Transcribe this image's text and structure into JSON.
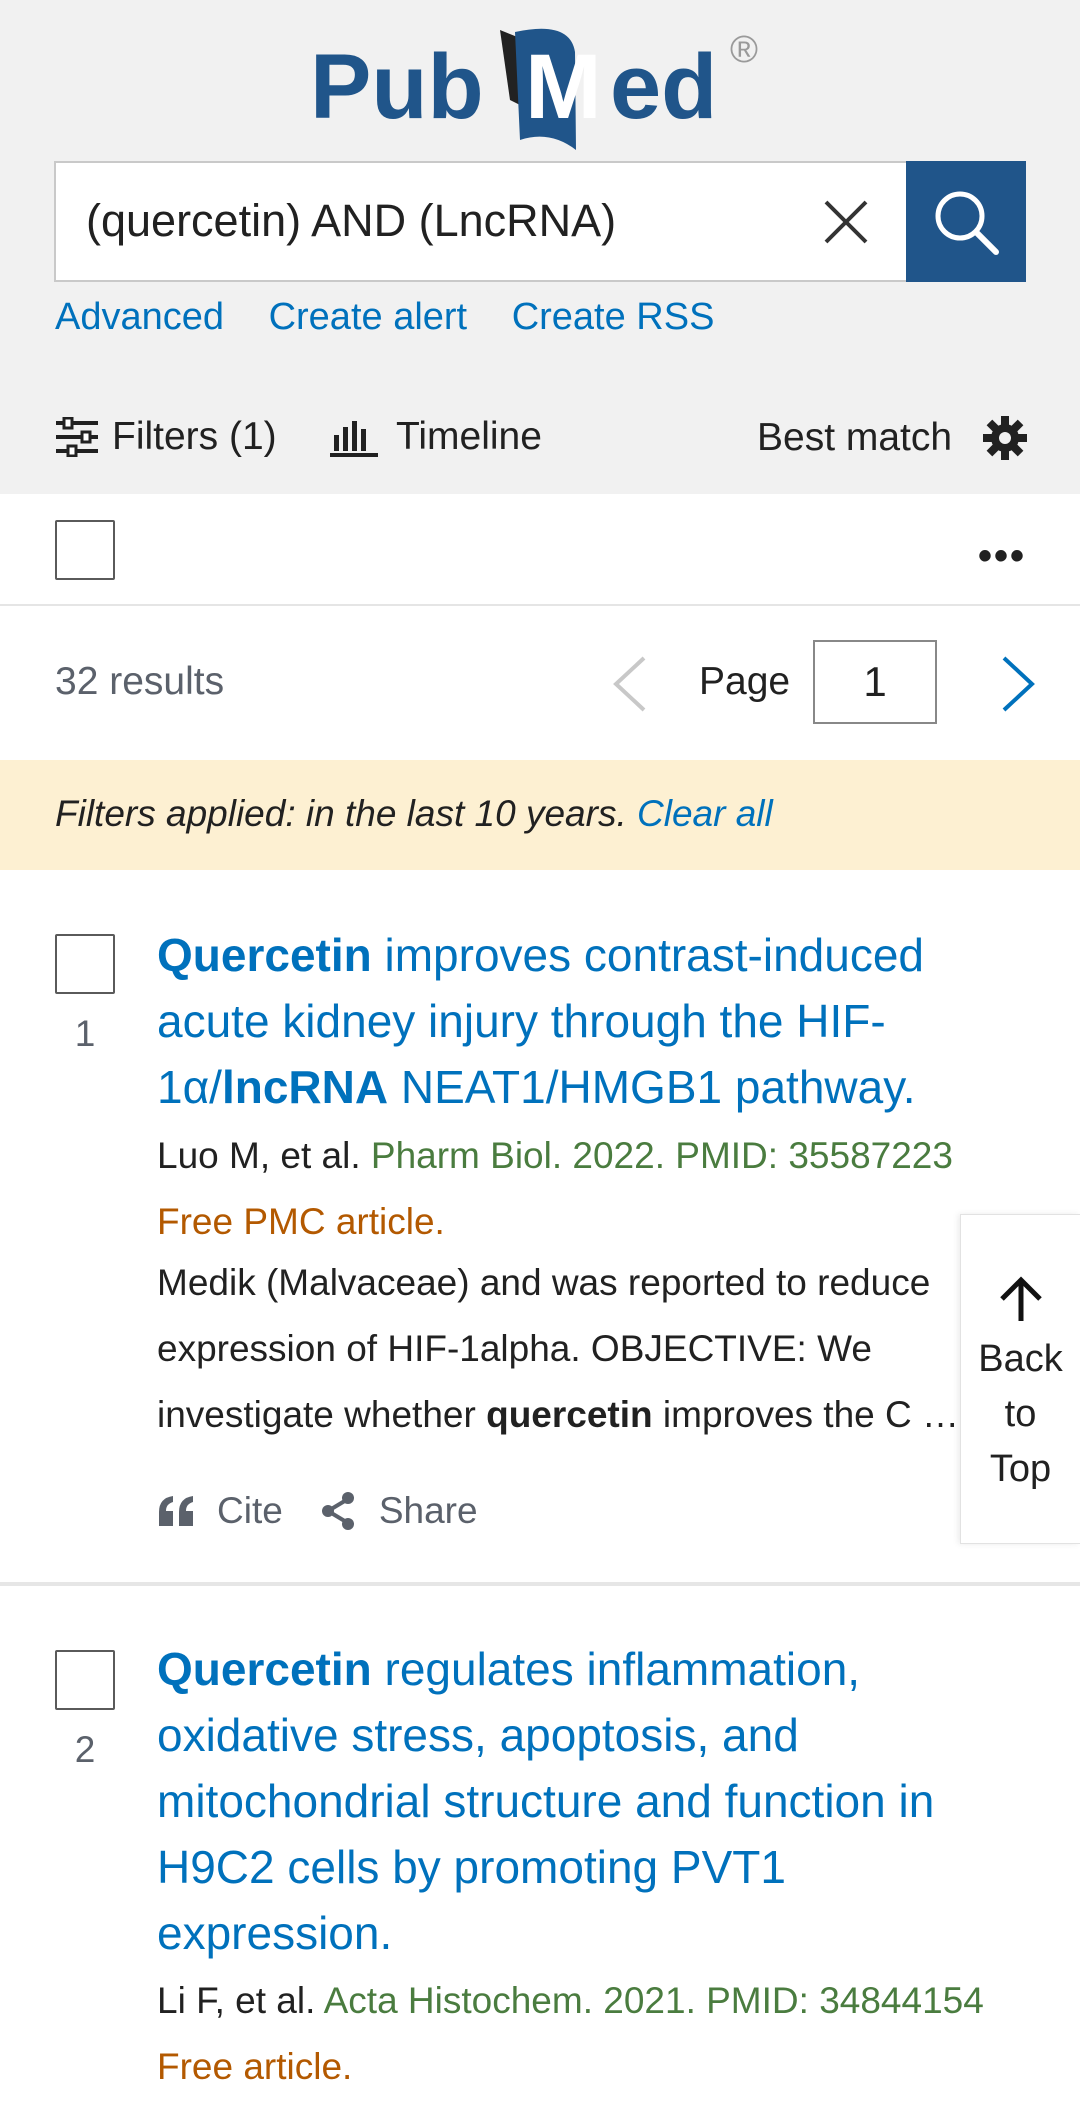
{
  "header": {
    "logo_text": "PubMed",
    "logo_registered": "®",
    "search_value": "(quercetin) AND (LncRNA)",
    "links": [
      "Advanced",
      "Create alert",
      "Create RSS"
    ]
  },
  "toolbar": {
    "filters_label": "Filters (1)",
    "timeline_label": "Timeline",
    "sort_label": "Best match"
  },
  "results": {
    "count_text": "32 results",
    "page_label": "Page",
    "page_value": "1"
  },
  "filter_bar": {
    "text": "Filters applied: in the last 10 years.",
    "clear_label": "Clear all"
  },
  "articles": [
    {
      "number": "1",
      "title_parts": [
        "Quercetin",
        " improves contrast-induced acute kidney injury through the HIF-1α/",
        "lncRNA",
        " NEAT1/HMGB1 pathway."
      ],
      "authors": "Luo M, et al.",
      "journal": "Pharm Biol. 2022. PMID: 35587223",
      "free": "Free PMC article.",
      "snippet_lines": [
        "Medik (Malvaceae) and was reported to reduce",
        "expression of HIF-1alpha. OBJECTIVE: We"
      ],
      "snippet_line3_pre": "investigate whether ",
      "snippet_line3_bold": "quercetin",
      "snippet_line3_post": " improves the C …",
      "cite_label": "Cite",
      "share_label": "Share"
    },
    {
      "number": "2",
      "title_parts": [
        "Quercetin",
        " regulates inflammation, oxidative stress, apoptosis, and mitochondrial structure and function in H9C2 cells by promoting PVT1 expression."
      ],
      "authors": "Li F, et al.",
      "journal": "Acta Histochem. 2021. PMID: 34844154",
      "free": "Free article."
    }
  ],
  "back_to_top": {
    "line1": "Back",
    "line2": "to",
    "line3": "Top"
  },
  "colors": {
    "brand_blue": "#20558a",
    "link_blue": "#0071bc",
    "journal_green": "#4a7c3f",
    "free_orange": "#b35900",
    "filter_bg": "#fdf0d2"
  }
}
